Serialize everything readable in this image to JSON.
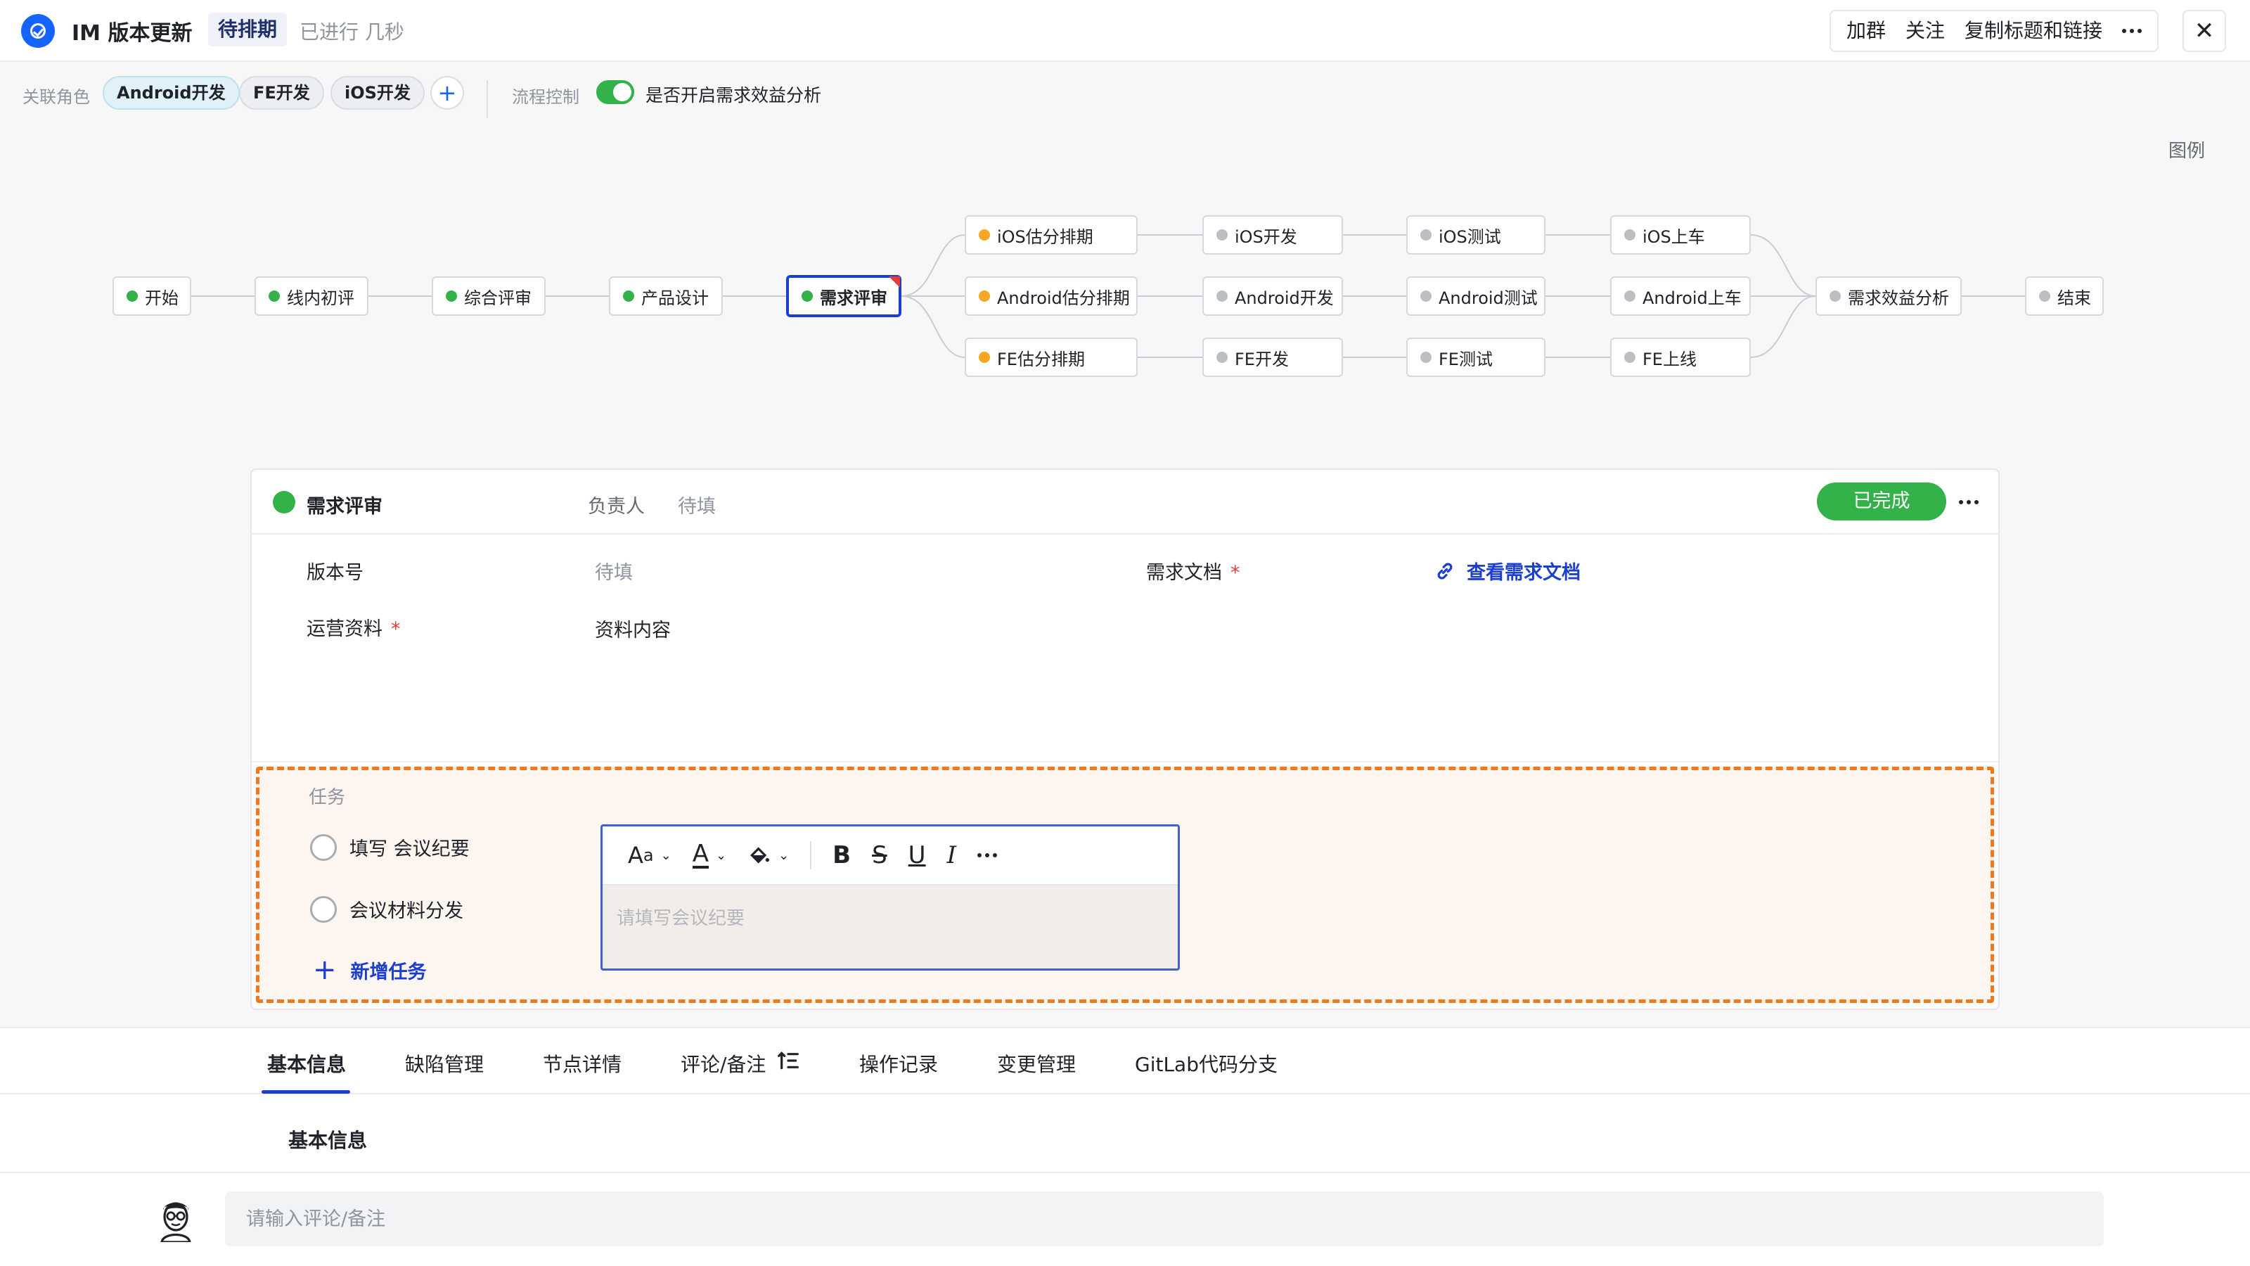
{
  "header": {
    "title": "IM 版本更新",
    "status": "待排期",
    "elapsed": "已进行 几秒",
    "actions": [
      "加群",
      "关注",
      "复制标题和链接"
    ]
  },
  "roles": {
    "label": "关联角色",
    "chips": [
      "Android开发",
      "FE开发",
      "iOS开发"
    ],
    "flow_control_label": "流程控制",
    "flow_toggle_text": "是否开启需求效益分析",
    "flow_toggle_on": true
  },
  "legend": "图例",
  "flow": {
    "main": [
      {
        "label": "开始",
        "status": "done"
      },
      {
        "label": "线内初评",
        "status": "done"
      },
      {
        "label": "综合评审",
        "status": "done"
      },
      {
        "label": "产品设计",
        "status": "done"
      },
      {
        "label": "需求评审",
        "status": "active"
      }
    ],
    "branches": [
      [
        "iOS估分排期",
        "iOS开发",
        "iOS测试",
        "iOS上车"
      ],
      [
        "Android估分排期",
        "Android开发",
        "Android测试",
        "Android上车"
      ],
      [
        "FE估分排期",
        "FE开发",
        "FE测试",
        "FE上线"
      ]
    ],
    "tail": [
      "需求效益分析",
      "结束"
    ]
  },
  "detail": {
    "title": "需求评审",
    "owner_label": "负责人",
    "owner_value": "待填",
    "complete_label": "已完成",
    "fields": {
      "version_label": "版本号",
      "version_value": "待填",
      "ops_label": "运营资料",
      "ops_value": "资料内容",
      "doc_label": "需求文档",
      "doc_link": "查看需求文档",
      "required_mark": "*"
    },
    "tasks": {
      "title": "任务",
      "items": [
        "填写 会议纪要",
        "会议材料分发"
      ],
      "add_label": "新增任务"
    }
  },
  "editor": {
    "placeholder": "请填写会议纪要",
    "tools": [
      "font-size-icon",
      "text-color-icon",
      "highlight-icon",
      "bold-icon",
      "strikethrough-icon",
      "underline-icon",
      "italic-icon",
      "more-icon"
    ]
  },
  "tabs": [
    "基本信息",
    "缺陷管理",
    "节点详情",
    "评论/备注",
    "操作记录",
    "变更管理",
    "GitLab代码分支"
  ],
  "basic_section_title": "基本信息",
  "comment": {
    "placeholder": "请输入评论/备注"
  },
  "colors": {
    "accent": "#1a3fd1",
    "success": "#34b24a",
    "warning": "#f5a623",
    "danger": "#e53b3b",
    "task_border": "#f0781e"
  }
}
